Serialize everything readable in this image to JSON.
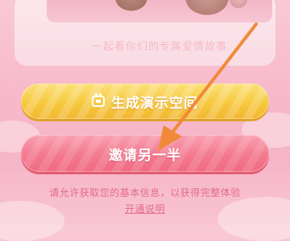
{
  "card": {
    "subtitle": "一起看你们的专属爱情故事"
  },
  "buttons": {
    "create_label": "生成演示空间",
    "create_icon": "room-icon",
    "invite_label": "邀请另一半"
  },
  "footer": {
    "info": "请允许获取您的基本信息，以获得完整体验",
    "link": "开通说明"
  },
  "colors": {
    "accent_yellow": "#f6c93f",
    "accent_pink": "#f3798e",
    "text_pink": "#e56b87",
    "annotation_arrow": "#f08a3a"
  }
}
